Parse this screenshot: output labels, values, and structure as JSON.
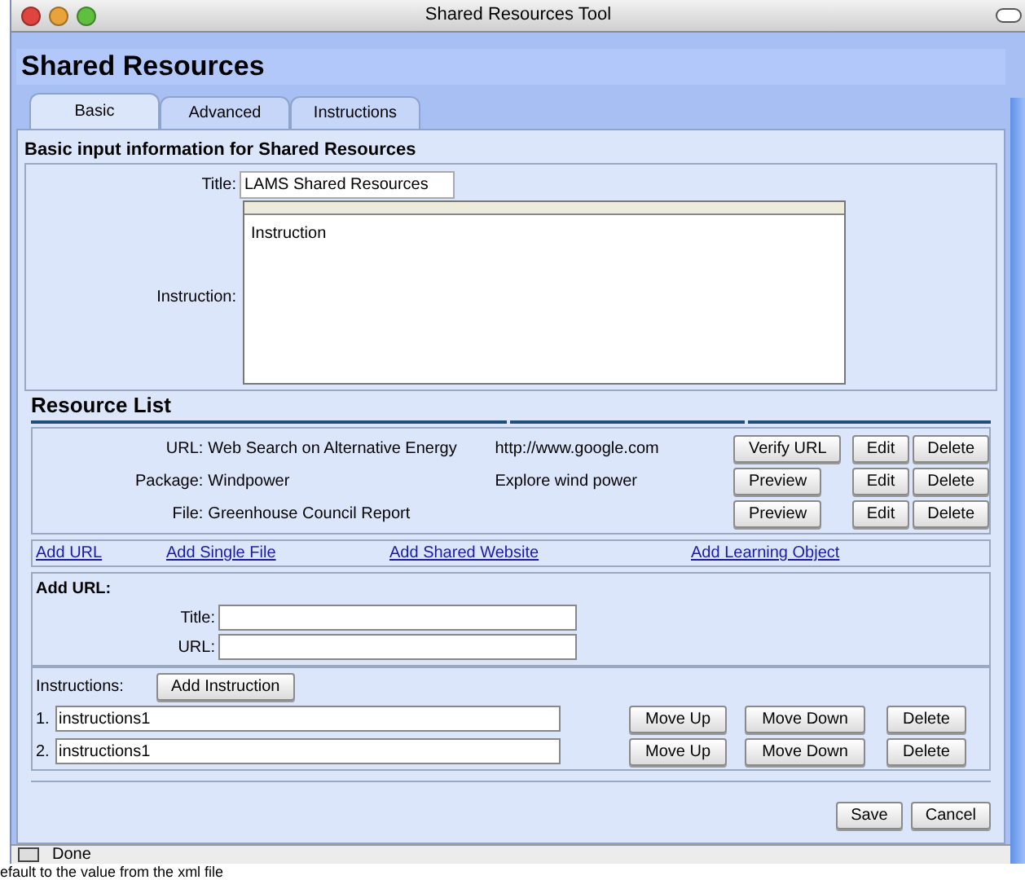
{
  "window": {
    "title": "Shared Resources Tool"
  },
  "header": {
    "title": "Shared Resources"
  },
  "tabs": [
    {
      "label": "Basic",
      "selected": true
    },
    {
      "label": "Advanced",
      "selected": false
    },
    {
      "label": "Instructions",
      "selected": false
    }
  ],
  "section_heading": "Basic input information for Shared Resources",
  "basic_form": {
    "title_label": "Title:",
    "title_value": "LAMS Shared Resources",
    "instruction_label": "Instruction:",
    "instruction_value": "Instruction"
  },
  "resource_list": {
    "heading": "Resource List",
    "rows": [
      {
        "type": "URL:",
        "label": "Web Search on Alternative Energy",
        "detail": "http://www.google.com",
        "action": "Verify URL",
        "edit": "Edit",
        "delete": "Delete"
      },
      {
        "type": "Package:",
        "label": "Windpower",
        "detail": "Explore wind power",
        "action": "Preview",
        "edit": "Edit",
        "delete": "Delete"
      },
      {
        "type": "File:",
        "label": "Greenhouse Council Report",
        "detail": "",
        "action": "Preview",
        "edit": "Edit",
        "delete": "Delete"
      }
    ]
  },
  "add_links": [
    "Add URL",
    "Add Single File",
    "Add Shared Website",
    "Add Learning Object"
  ],
  "add_url": {
    "heading": "Add URL:",
    "fields": [
      {
        "label": "Title:"
      },
      {
        "label": "URL:"
      }
    ]
  },
  "instructions": {
    "label": "Instructions:",
    "add_button": "Add Instruction",
    "items": [
      {
        "number": "1.",
        "value": "instructions1",
        "move_up": "Move Up",
        "move_down": "Move Down",
        "delete": "Delete"
      },
      {
        "number": "2.",
        "value": "instructions1",
        "move_up": "Move Up",
        "move_down": "Move Down",
        "delete": "Delete"
      }
    ]
  },
  "footer_buttons": [
    "Save",
    "Cancel"
  ],
  "status_bar": {
    "text": "Done"
  },
  "background_text": "efault to the value from the xml file"
}
